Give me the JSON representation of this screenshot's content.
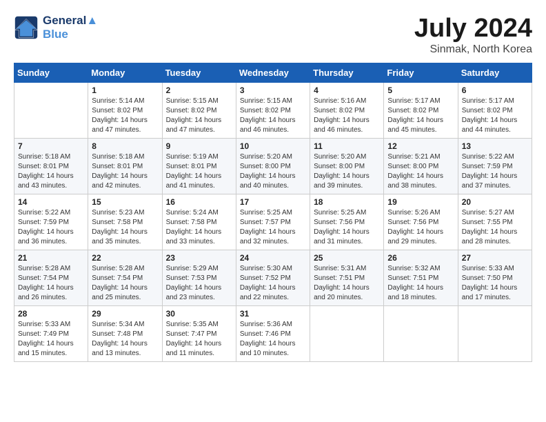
{
  "header": {
    "logo_line1": "General",
    "logo_line2": "Blue",
    "month_year": "July 2024",
    "location": "Sinmak, North Korea"
  },
  "weekdays": [
    "Sunday",
    "Monday",
    "Tuesday",
    "Wednesday",
    "Thursday",
    "Friday",
    "Saturday"
  ],
  "weeks": [
    [
      {
        "day": null
      },
      {
        "day": "1",
        "sunrise": "5:14 AM",
        "sunset": "8:02 PM",
        "daylight": "14 hours and 47 minutes."
      },
      {
        "day": "2",
        "sunrise": "5:15 AM",
        "sunset": "8:02 PM",
        "daylight": "14 hours and 47 minutes."
      },
      {
        "day": "3",
        "sunrise": "5:15 AM",
        "sunset": "8:02 PM",
        "daylight": "14 hours and 46 minutes."
      },
      {
        "day": "4",
        "sunrise": "5:16 AM",
        "sunset": "8:02 PM",
        "daylight": "14 hours and 46 minutes."
      },
      {
        "day": "5",
        "sunrise": "5:17 AM",
        "sunset": "8:02 PM",
        "daylight": "14 hours and 45 minutes."
      },
      {
        "day": "6",
        "sunrise": "5:17 AM",
        "sunset": "8:02 PM",
        "daylight": "14 hours and 44 minutes."
      }
    ],
    [
      {
        "day": "7",
        "sunrise": "5:18 AM",
        "sunset": "8:01 PM",
        "daylight": "14 hours and 43 minutes."
      },
      {
        "day": "8",
        "sunrise": "5:18 AM",
        "sunset": "8:01 PM",
        "daylight": "14 hours and 42 minutes."
      },
      {
        "day": "9",
        "sunrise": "5:19 AM",
        "sunset": "8:01 PM",
        "daylight": "14 hours and 41 minutes."
      },
      {
        "day": "10",
        "sunrise": "5:20 AM",
        "sunset": "8:00 PM",
        "daylight": "14 hours and 40 minutes."
      },
      {
        "day": "11",
        "sunrise": "5:20 AM",
        "sunset": "8:00 PM",
        "daylight": "14 hours and 39 minutes."
      },
      {
        "day": "12",
        "sunrise": "5:21 AM",
        "sunset": "8:00 PM",
        "daylight": "14 hours and 38 minutes."
      },
      {
        "day": "13",
        "sunrise": "5:22 AM",
        "sunset": "7:59 PM",
        "daylight": "14 hours and 37 minutes."
      }
    ],
    [
      {
        "day": "14",
        "sunrise": "5:22 AM",
        "sunset": "7:59 PM",
        "daylight": "14 hours and 36 minutes."
      },
      {
        "day": "15",
        "sunrise": "5:23 AM",
        "sunset": "7:58 PM",
        "daylight": "14 hours and 35 minutes."
      },
      {
        "day": "16",
        "sunrise": "5:24 AM",
        "sunset": "7:58 PM",
        "daylight": "14 hours and 33 minutes."
      },
      {
        "day": "17",
        "sunrise": "5:25 AM",
        "sunset": "7:57 PM",
        "daylight": "14 hours and 32 minutes."
      },
      {
        "day": "18",
        "sunrise": "5:25 AM",
        "sunset": "7:56 PM",
        "daylight": "14 hours and 31 minutes."
      },
      {
        "day": "19",
        "sunrise": "5:26 AM",
        "sunset": "7:56 PM",
        "daylight": "14 hours and 29 minutes."
      },
      {
        "day": "20",
        "sunrise": "5:27 AM",
        "sunset": "7:55 PM",
        "daylight": "14 hours and 28 minutes."
      }
    ],
    [
      {
        "day": "21",
        "sunrise": "5:28 AM",
        "sunset": "7:54 PM",
        "daylight": "14 hours and 26 minutes."
      },
      {
        "day": "22",
        "sunrise": "5:28 AM",
        "sunset": "7:54 PM",
        "daylight": "14 hours and 25 minutes."
      },
      {
        "day": "23",
        "sunrise": "5:29 AM",
        "sunset": "7:53 PM",
        "daylight": "14 hours and 23 minutes."
      },
      {
        "day": "24",
        "sunrise": "5:30 AM",
        "sunset": "7:52 PM",
        "daylight": "14 hours and 22 minutes."
      },
      {
        "day": "25",
        "sunrise": "5:31 AM",
        "sunset": "7:51 PM",
        "daylight": "14 hours and 20 minutes."
      },
      {
        "day": "26",
        "sunrise": "5:32 AM",
        "sunset": "7:51 PM",
        "daylight": "14 hours and 18 minutes."
      },
      {
        "day": "27",
        "sunrise": "5:33 AM",
        "sunset": "7:50 PM",
        "daylight": "14 hours and 17 minutes."
      }
    ],
    [
      {
        "day": "28",
        "sunrise": "5:33 AM",
        "sunset": "7:49 PM",
        "daylight": "14 hours and 15 minutes."
      },
      {
        "day": "29",
        "sunrise": "5:34 AM",
        "sunset": "7:48 PM",
        "daylight": "14 hours and 13 minutes."
      },
      {
        "day": "30",
        "sunrise": "5:35 AM",
        "sunset": "7:47 PM",
        "daylight": "14 hours and 11 minutes."
      },
      {
        "day": "31",
        "sunrise": "5:36 AM",
        "sunset": "7:46 PM",
        "daylight": "14 hours and 10 minutes."
      },
      {
        "day": null
      },
      {
        "day": null
      },
      {
        "day": null
      }
    ]
  ]
}
